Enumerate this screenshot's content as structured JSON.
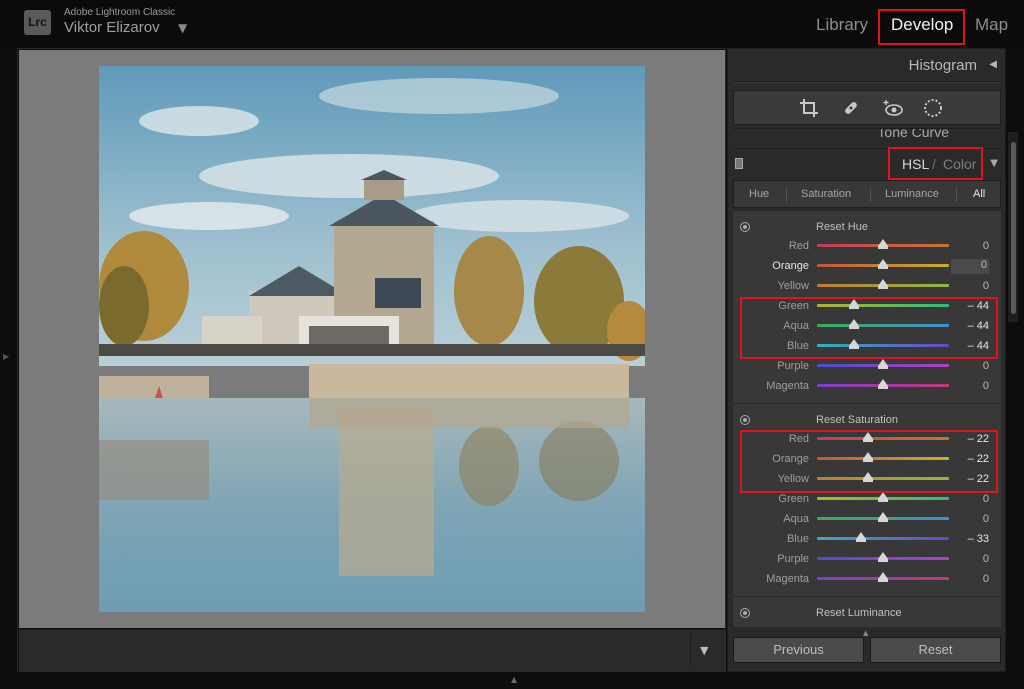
{
  "app": {
    "logo": "Lrc",
    "name": "Adobe Lightroom Classic",
    "user": "Viktor Elizarov",
    "user_caret": "▼"
  },
  "modules": {
    "library": "Library",
    "develop": "Develop",
    "map": "Map",
    "active": "Develop"
  },
  "right_panel": {
    "histogram": "Histogram",
    "tone_curve": "Tone Curve",
    "hsl_title": "HSL",
    "hsl_sep": "/",
    "hsl_color": "Color",
    "tools": [
      "crop-icon",
      "healing-icon",
      "red-eye-icon",
      "masking-icon"
    ],
    "tabs": [
      {
        "label": "Hue"
      },
      {
        "label": "Saturation"
      },
      {
        "label": "Luminance"
      },
      {
        "label": "All"
      }
    ],
    "active_tab": "All",
    "hue": {
      "reset_label": "Reset Hue",
      "rows": [
        {
          "label": "Red",
          "value": "0"
        },
        {
          "label": "Orange",
          "value": "0"
        },
        {
          "label": "Yellow",
          "value": "0"
        },
        {
          "label": "Green",
          "value": "– 44"
        },
        {
          "label": "Aqua",
          "value": "– 44"
        },
        {
          "label": "Blue",
          "value": "– 44"
        },
        {
          "label": "Purple",
          "value": "0"
        },
        {
          "label": "Magenta",
          "value": "0"
        }
      ]
    },
    "saturation": {
      "reset_label": "Reset Saturation",
      "rows": [
        {
          "label": "Red",
          "value": "– 22"
        },
        {
          "label": "Orange",
          "value": "– 22"
        },
        {
          "label": "Yellow",
          "value": "– 22"
        },
        {
          "label": "Green",
          "value": "0"
        },
        {
          "label": "Aqua",
          "value": "0"
        },
        {
          "label": "Blue",
          "value": "– 33"
        },
        {
          "label": "Purple",
          "value": "0"
        },
        {
          "label": "Magenta",
          "value": "0"
        }
      ]
    },
    "luminance": {
      "reset_label": "Reset Luminance"
    },
    "buttons": {
      "previous": "Previous",
      "reset": "Reset"
    }
  },
  "colors": {
    "highlight_box": "#e0141e",
    "panel_bg": "#383838",
    "canvas_bg": "#7b7b7b"
  }
}
